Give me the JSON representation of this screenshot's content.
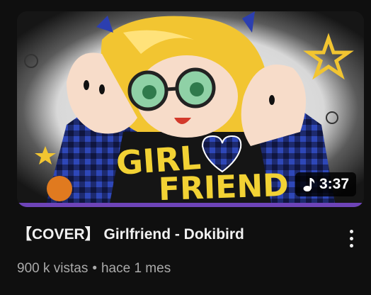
{
  "video": {
    "title": "【COVER】 Girlfriend - Dokibird",
    "views": "900 k vistas",
    "separator": "•",
    "age": "hace 1 mes",
    "duration": "3:37",
    "watched_fraction": 1.0,
    "thumbnail_text": "GIRLFRIEND"
  },
  "icons": {
    "duration": "music-note-icon",
    "menu": "more-vert-icon"
  },
  "colors": {
    "background": "#0f0f0f",
    "progress": "#6e44b8",
    "title": "#f1f1f1",
    "meta": "#aaaaaa"
  }
}
